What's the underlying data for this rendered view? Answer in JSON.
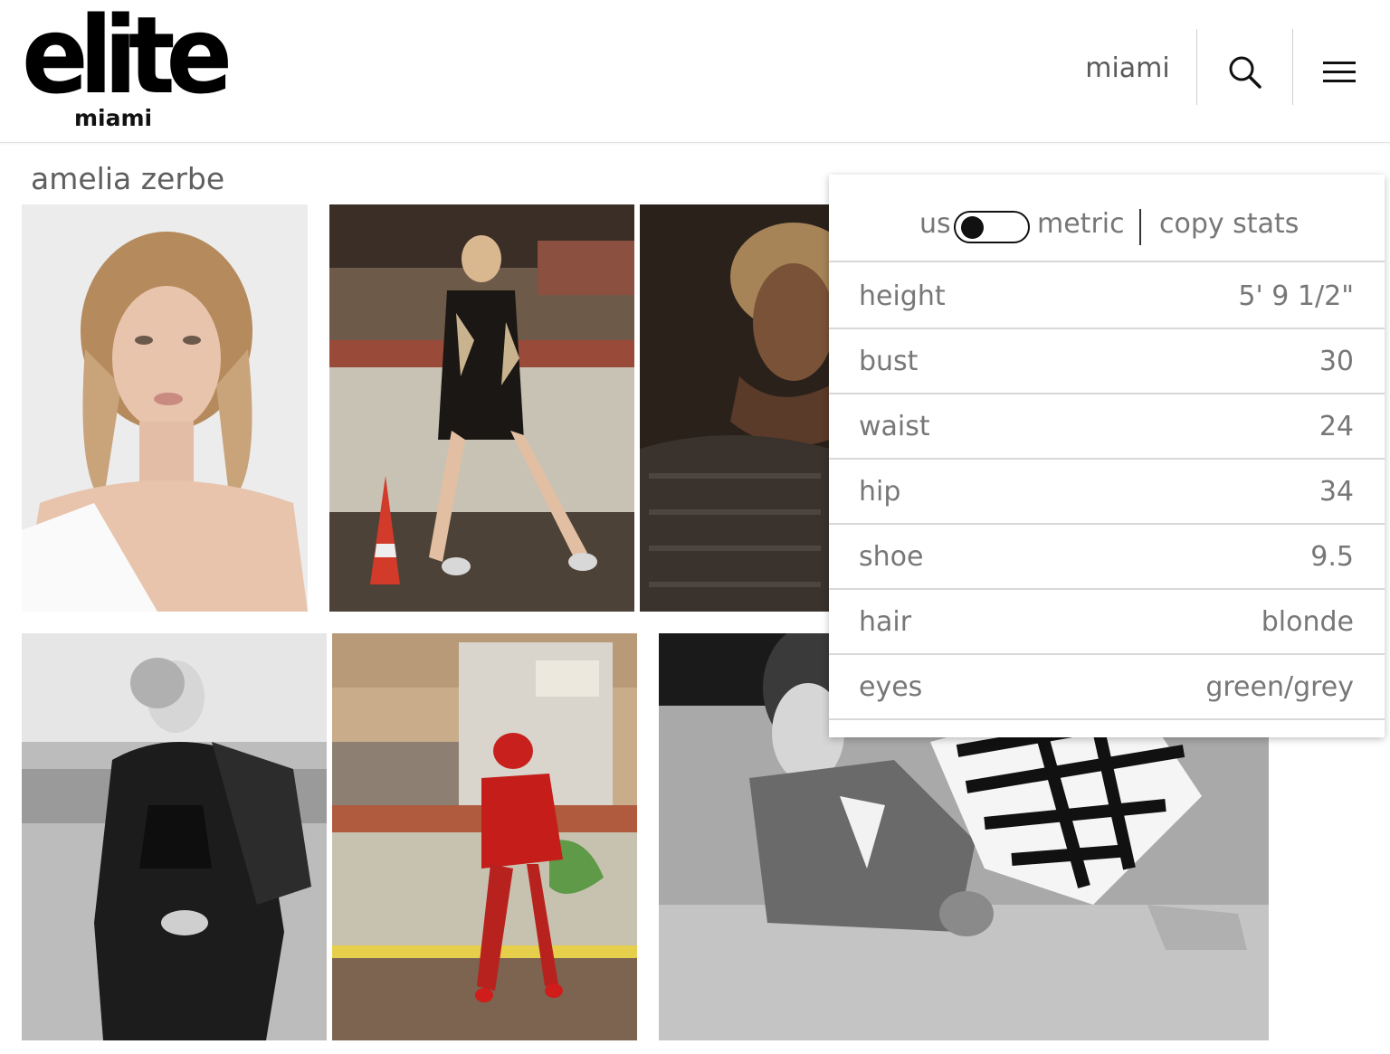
{
  "header": {
    "logo_word": "elite",
    "logo_sub": "miami",
    "city": "miami",
    "search_icon": "search-icon",
    "menu_icon": "hamburger-menu-icon"
  },
  "model": {
    "name": "amelia zerbe"
  },
  "stats_panel": {
    "unit_us": "us",
    "unit_metric": "metric",
    "copy_label": "copy stats",
    "toggle_state": "us",
    "rows": [
      {
        "label": "height",
        "value": "5' 9 1/2\""
      },
      {
        "label": "bust",
        "value": "30"
      },
      {
        "label": "waist",
        "value": "24"
      },
      {
        "label": "hip",
        "value": "34"
      },
      {
        "label": "shoe",
        "value": "9.5"
      },
      {
        "label": "hair",
        "value": "blonde"
      },
      {
        "label": "eyes",
        "value": "green/grey"
      }
    ]
  },
  "photos": [
    {
      "name": "portrait-headshot"
    },
    {
      "name": "seated-street-editorial"
    },
    {
      "name": "dark-closeup-editorial"
    },
    {
      "name": "bw-leather-jacket-editorial"
    },
    {
      "name": "red-outfit-street-editorial"
    },
    {
      "name": "bw-zebra-print-editorial"
    }
  ],
  "colors": {
    "text": "#666666",
    "divider": "#d8d8d8",
    "toggle": "#111111"
  }
}
